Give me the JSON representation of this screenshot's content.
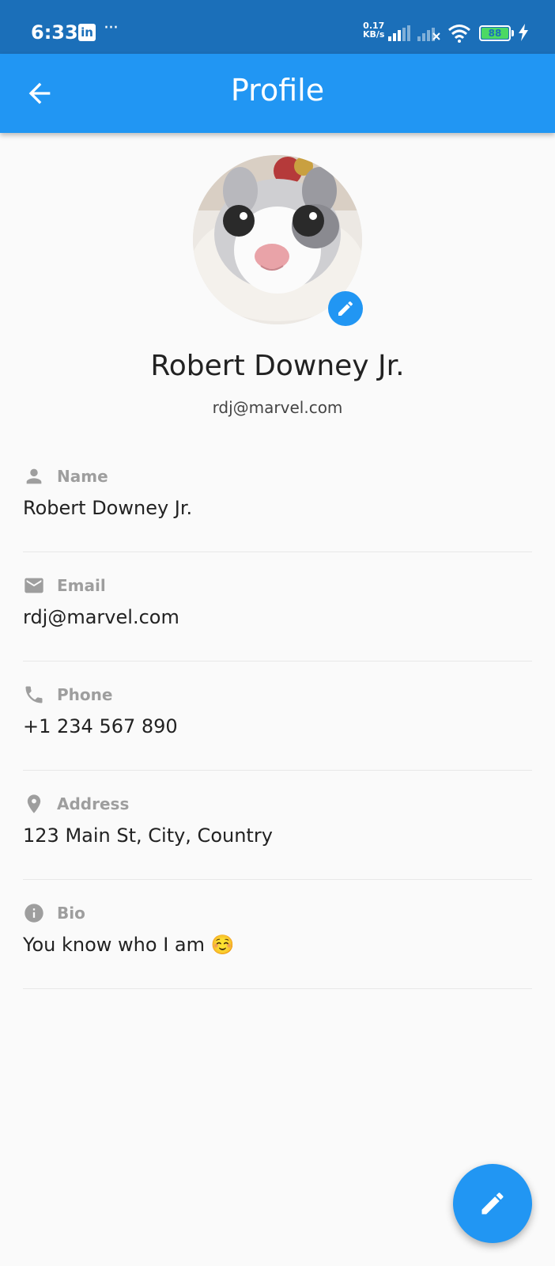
{
  "status_bar": {
    "time": "6:33",
    "app_badge": "in",
    "overflow": "···",
    "speed_value": "0.17",
    "speed_unit": "KB/s",
    "battery": "88"
  },
  "app_bar": {
    "title": "Profile",
    "back_icon": "arrow-back-icon",
    "color": "#2196f3"
  },
  "profile": {
    "name": "Robert Downey Jr.",
    "email": "rdj@marvel.com",
    "avatar_edit_icon": "pencil-icon"
  },
  "fields": [
    {
      "icon": "person-icon",
      "label": "Name",
      "value": "Robert Downey Jr."
    },
    {
      "icon": "email-icon",
      "label": "Email",
      "value": "rdj@marvel.com"
    },
    {
      "icon": "phone-icon",
      "label": "Phone",
      "value": "+1 234 567 890"
    },
    {
      "icon": "location-icon",
      "label": "Address",
      "value": "123 Main St, City, Country"
    },
    {
      "icon": "info-icon",
      "label": "Bio",
      "value": "You know who I am ☺️"
    }
  ],
  "fab": {
    "icon": "pencil-icon"
  }
}
